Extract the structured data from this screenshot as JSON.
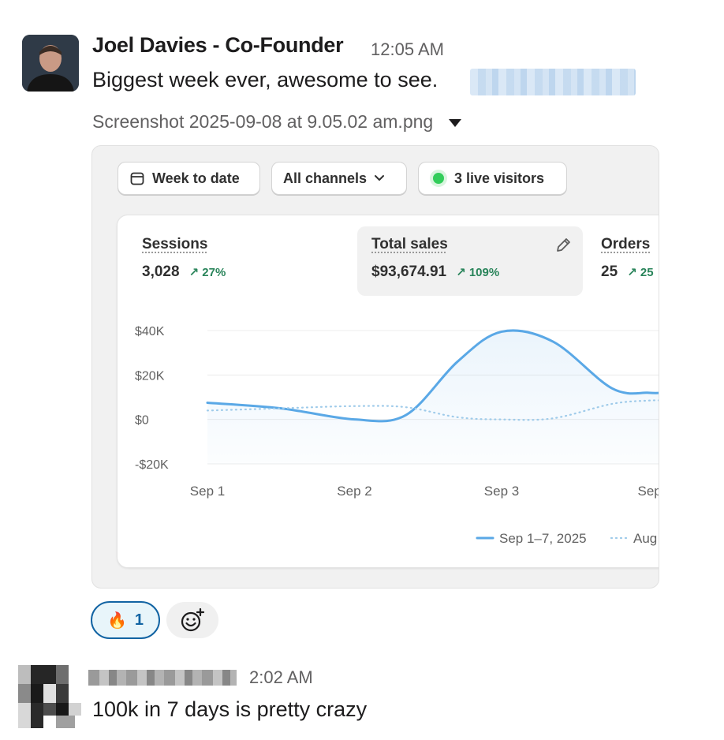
{
  "message1": {
    "author": "Joel Davies - Co-Founder",
    "time": "12:05 AM",
    "text": "Biggest week ever, awesome to see.",
    "attachment_name": "Screenshot 2025-09-08 at 9.05.02 am.png"
  },
  "dashboard": {
    "filters": {
      "date_range": "Week to date",
      "channels": "All channels",
      "live_visitors": "3 live visitors"
    },
    "metrics": [
      {
        "label": "Sessions",
        "value": "3,028",
        "change": "27%"
      },
      {
        "label": "Total sales",
        "value": "$93,674.91",
        "change": "109%"
      },
      {
        "label": "Orders",
        "value": "25",
        "change": "25"
      }
    ]
  },
  "chart_data": {
    "type": "line",
    "x": [
      "Sep 1",
      "Sep 2",
      "Sep 3",
      "Sep"
    ],
    "y_ticks": [
      "$40K",
      "$20K",
      "$0",
      "-$20K"
    ],
    "ylim": [
      -20000,
      40000
    ],
    "series": [
      {
        "name": "Sep 1–7, 2025",
        "style": "solid",
        "color": "#5aa8e6",
        "points": [
          [
            0,
            7500
          ],
          [
            0.5,
            5000
          ],
          [
            1.0,
            0
          ],
          [
            1.35,
            2000
          ],
          [
            1.7,
            26000
          ],
          [
            2.0,
            39500
          ],
          [
            2.35,
            35000
          ],
          [
            2.75,
            14000
          ],
          [
            3.0,
            12000
          ],
          [
            3.1,
            12000
          ]
        ]
      },
      {
        "name": "Aug",
        "style": "dotted",
        "color": "#9fcbea",
        "points": [
          [
            0,
            4000
          ],
          [
            0.5,
            5000
          ],
          [
            1.0,
            6000
          ],
          [
            1.35,
            5500
          ],
          [
            1.7,
            1000
          ],
          [
            2.0,
            0
          ],
          [
            2.35,
            500
          ],
          [
            2.75,
            7000
          ],
          [
            3.0,
            8500
          ],
          [
            3.1,
            8500
          ]
        ]
      }
    ]
  },
  "reactions": [
    {
      "emoji": "🔥",
      "count": "1"
    }
  ],
  "message2": {
    "time": "2:02 AM",
    "text": "100k in 7 days is pretty crazy"
  }
}
